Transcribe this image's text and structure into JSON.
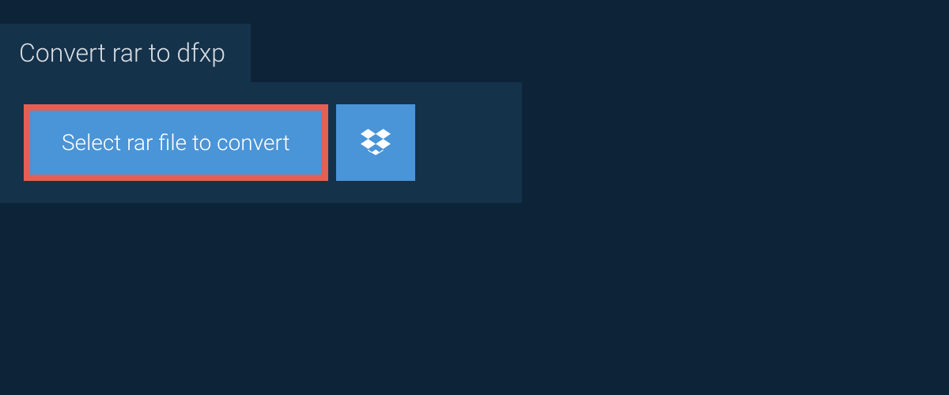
{
  "header": {
    "title": "Convert rar to dfxp"
  },
  "actions": {
    "select_file_label": "Select rar file to convert"
  }
}
